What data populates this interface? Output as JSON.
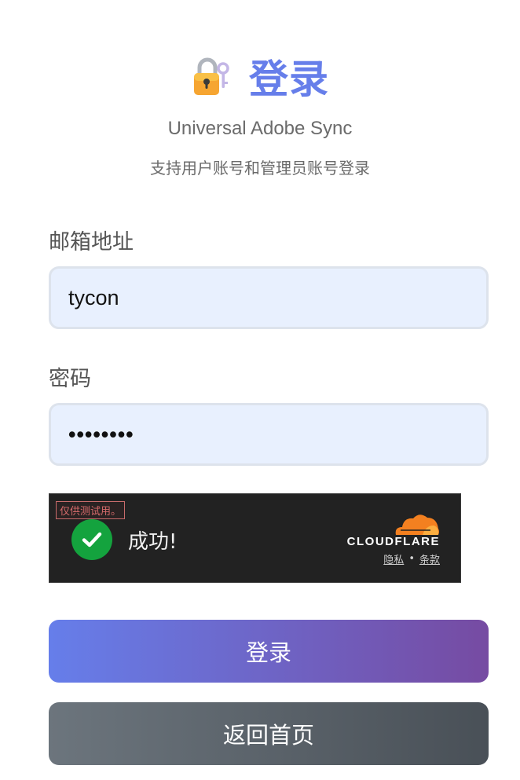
{
  "header": {
    "icon": "locked-with-key-icon",
    "title": "登录",
    "subtitle": "Universal Adobe Sync",
    "hint": "支持用户账号和管理员账号登录"
  },
  "form": {
    "email_label": "邮箱地址",
    "email_value": "tycon",
    "password_label": "密码",
    "password_value": "••••••••"
  },
  "captcha": {
    "test_badge": "仅供测试用。",
    "status": "成功!",
    "brand": "CLOUDFLARE",
    "privacy_link": "隐私",
    "separator": "•",
    "terms_link": "条款",
    "status_color": "#14a33e",
    "brand_color": "#f38020"
  },
  "buttons": {
    "login": "登录",
    "home": "返回首页"
  },
  "colors": {
    "accent": "#667eea",
    "accent_end": "#764ba2",
    "secondary": "#6c757d"
  }
}
